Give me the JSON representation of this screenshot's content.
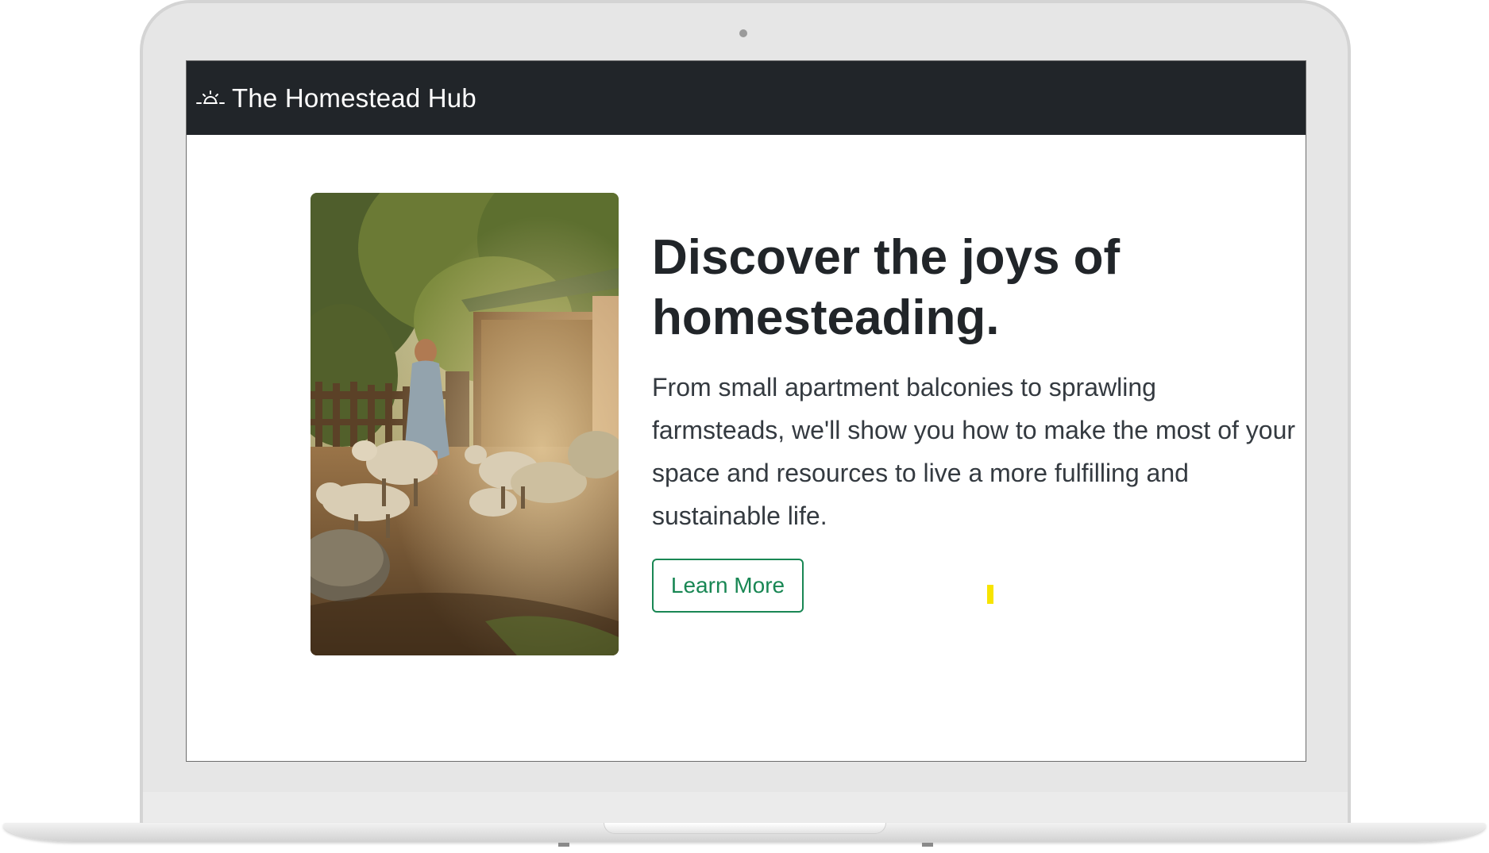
{
  "navbar": {
    "brand_icon": "sunrise-icon",
    "brand_label": "The Homestead Hub",
    "background": "#212529"
  },
  "hero": {
    "image": "woman-with-sheep-photo",
    "headline": "Discover the joys of homesteading.",
    "lead": "From small apartment balconies to sprawling farmsteads, we'll show you how to make the most of your space and resources to live a more fulfilling and sustainable life.",
    "button_label": "Learn More"
  },
  "colors": {
    "accent": "#198754",
    "text": "#212529",
    "cursor_highlight": "#f7e400"
  }
}
